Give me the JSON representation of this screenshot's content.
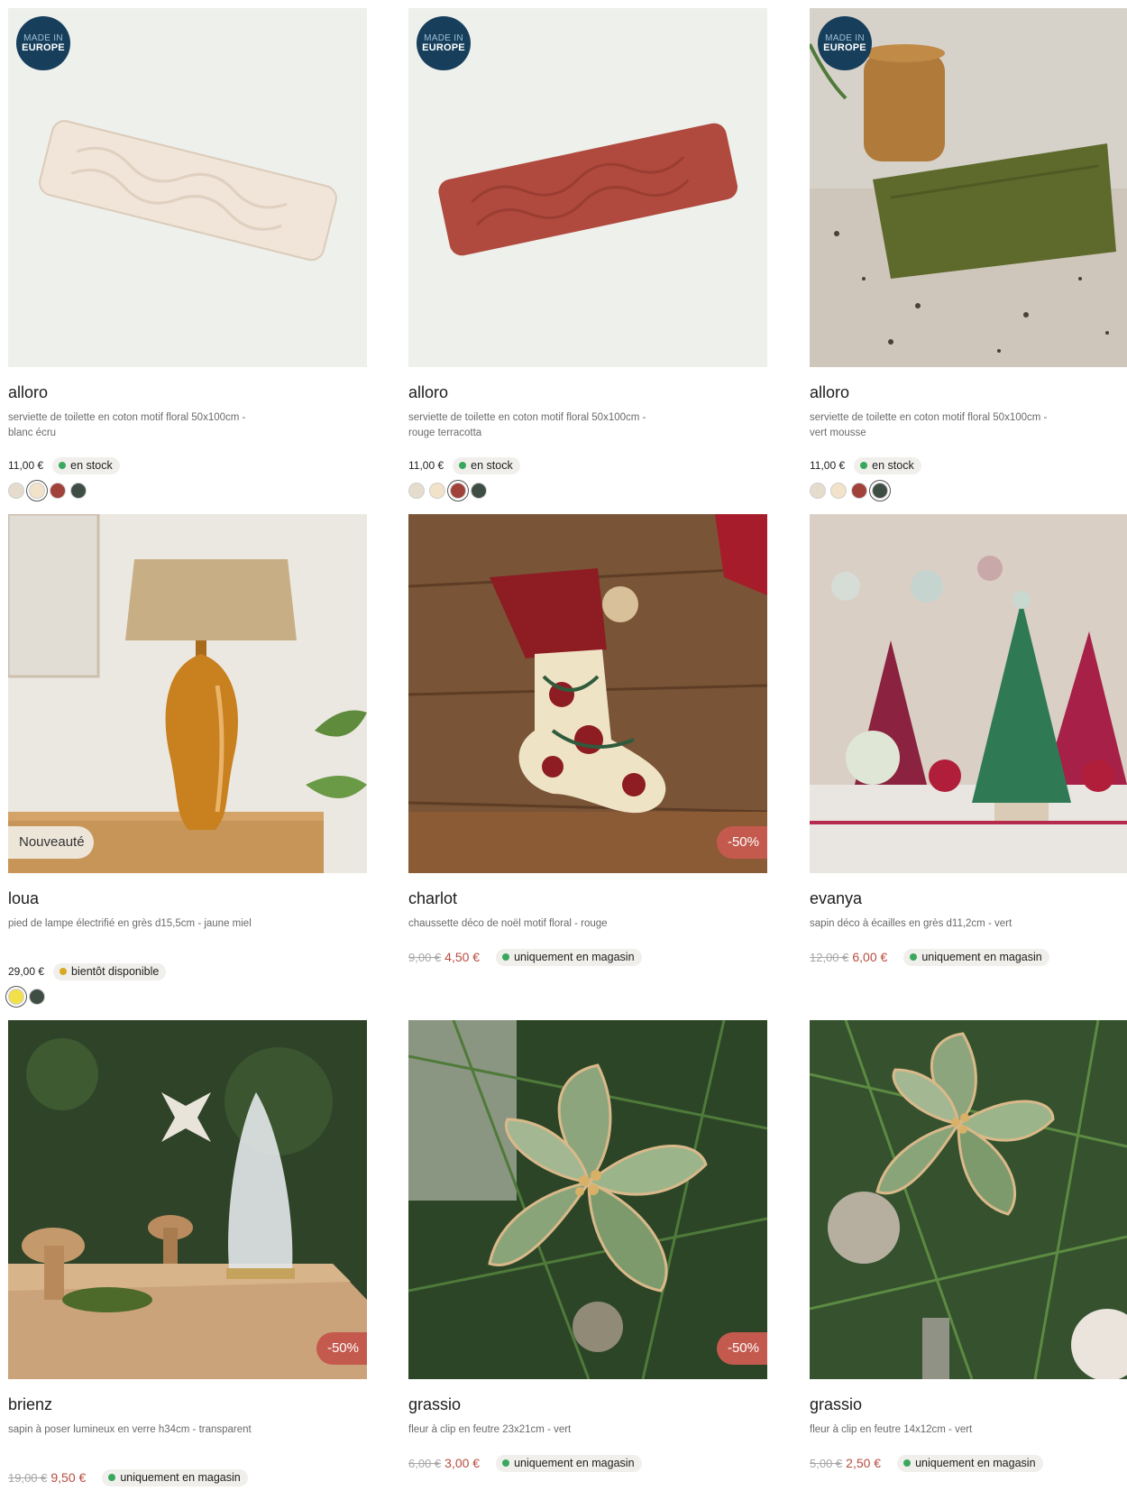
{
  "products": [
    {
      "name": "alloro",
      "description": "serviette de toilette en coton motif floral 50x100cm - blanc écru",
      "price": "11,00 €",
      "stock": "en stock",
      "stock_color": "#3aa85c",
      "badge": "MADE IN EUROPE",
      "badge_line1": "MADE IN",
      "badge_line2": "EUROPE",
      "swatches": [
        "#e6dccd",
        "#f1e2c9",
        "#a0413a",
        "#3f4e45"
      ],
      "selected_swatch": 1
    },
    {
      "name": "alloro",
      "description": "serviette de toilette en coton motif floral 50x100cm - rouge terracotta",
      "price": "11,00 €",
      "stock": "en stock",
      "stock_color": "#3aa85c",
      "badge_line1": "MADE IN",
      "badge_line2": "EUROPE",
      "swatches": [
        "#e6dccd",
        "#f1e2c9",
        "#a0413a",
        "#3f4e45"
      ],
      "selected_swatch": 2
    },
    {
      "name": "alloro",
      "description": "serviette de toilette en coton motif floral 50x100cm - vert mousse",
      "price": "11,00 €",
      "stock": "en stock",
      "stock_color": "#3aa85c",
      "badge_line1": "MADE IN",
      "badge_line2": "EUROPE",
      "swatches": [
        "#e6dccd",
        "#f1e2c9",
        "#a0413a",
        "#3f4e45"
      ],
      "selected_swatch": 3
    },
    {
      "name": "loua",
      "description": "pied de lampe électrifié en grès d15,5cm - jaune miel",
      "price": "29,00 €",
      "stock": "bientôt disponible",
      "stock_color": "#d9a81f",
      "tag": "Nouveauté",
      "swatches": [
        "#f2e04a",
        "#3f4e45"
      ],
      "selected_swatch": 0
    },
    {
      "name": "charlot",
      "description": "chaussette déco de noël motif floral - rouge",
      "old_price": "9,00 €",
      "new_price": "4,50 €",
      "stock": "uniquement en magasin",
      "stock_color": "#3aa85c",
      "discount": "-50%"
    },
    {
      "name": "evanya",
      "description": "sapin déco à écailles en grès d11,2cm - vert",
      "old_price": "12,00 €",
      "new_price": "6,00 €",
      "stock": "uniquement en magasin",
      "stock_color": "#3aa85c"
    },
    {
      "name": "brienz",
      "description": "sapin à poser lumineux en verre h34cm - transparent",
      "old_price": "19,00 €",
      "new_price": "9,50 €",
      "stock": "uniquement en magasin",
      "stock_color": "#3aa85c",
      "discount": "-50%"
    },
    {
      "name": "grassio",
      "description": "fleur à clip en feutre 23x21cm - vert",
      "old_price": "6,00 €",
      "new_price": "3,00 €",
      "stock": "uniquement en magasin",
      "stock_color": "#3aa85c",
      "discount": "-50%"
    },
    {
      "name": "grassio",
      "description": "fleur à clip en feutre 14x12cm - vert",
      "old_price": "5,00 €",
      "new_price": "2,50 €",
      "stock": "uniquement en magasin",
      "stock_color": "#3aa85c"
    }
  ],
  "icons": {
    "product_image": "product-photo",
    "stock_dot": "status-dot"
  }
}
